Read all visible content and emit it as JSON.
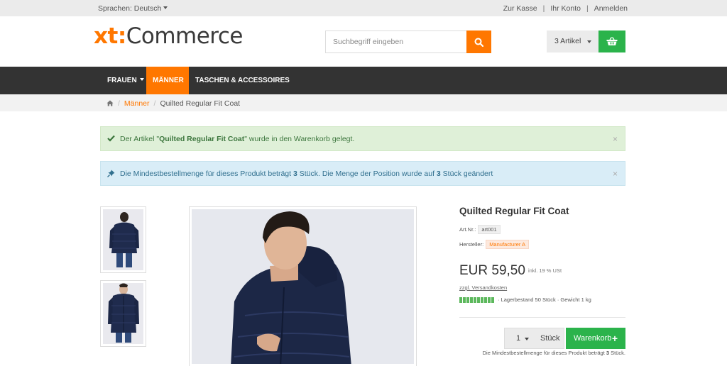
{
  "topbar": {
    "language": "Sprachen: Deutsch",
    "links": [
      "Zur Kasse",
      "Ihr Konto",
      "Anmelden"
    ]
  },
  "header": {
    "logo_prefix": "xt:",
    "logo_suffix": "Commerce",
    "search_placeholder": "Suchbegriff eingeben",
    "cart_label": "3 Artikel"
  },
  "nav": {
    "items": [
      {
        "label": "FRAUEN",
        "dropdown": true
      },
      {
        "label": "MÄNNER",
        "active": true
      },
      {
        "label": "TASCHEN & ACCESSOIRES"
      }
    ]
  },
  "breadcrumb": {
    "category": "Männer",
    "current": "Quilted Regular Fit Coat"
  },
  "alerts": {
    "success": {
      "pre": "Der Artikel \"",
      "bold": "Quilted Regular Fit Coat",
      "post": "\" wurde in den Warenkorb gelegt.",
      "close": "×"
    },
    "info": {
      "pre": "Die Mindestbestellmenge für dieses Produkt beträgt ",
      "q1": "3",
      "mid": " Stück. Die Menge der Position wurde auf ",
      "q2": "3",
      "post": " Stück geändert",
      "close": "×"
    }
  },
  "product": {
    "title": "Quilted Regular Fit Coat",
    "artnr_label": "Art.Nr.:",
    "artnr": "art001",
    "manufacturer_label": "Hersteller:",
    "manufacturer": "Manufacturer A",
    "price": "EUR 59,50",
    "vat": "inkl. 19 % USt",
    "shipping": "zzgl. Versandkosten",
    "stock": "· Lagerbestand 50 Stück",
    "weight": "· Gewicht 1 kg",
    "stock_level": 1.0,
    "qty": "1",
    "unit": "Stück",
    "add_label": "Warenkorb",
    "add_plus": "+",
    "min_note_pre": "Die Mindestbestellmenge für dieses Produkt beträgt ",
    "min_note_qty": "3",
    "min_note_post": " Stück."
  },
  "colors": {
    "accent": "#ff7700",
    "green": "#2bb34b",
    "nav_bg": "#333333"
  }
}
